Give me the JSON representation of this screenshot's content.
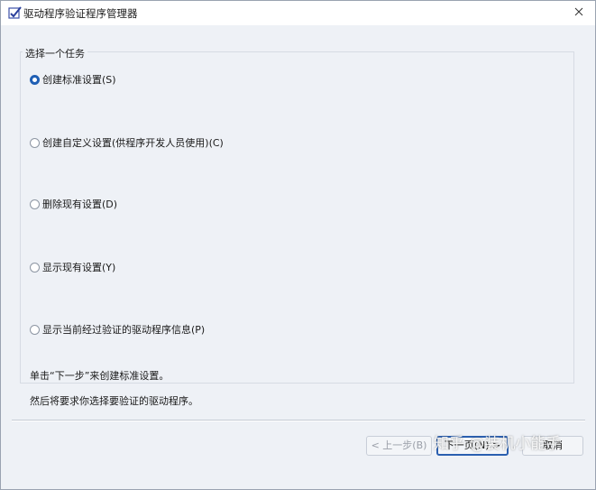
{
  "window": {
    "title": "驱动程序验证程序管理器",
    "app_icon": "checklist-app-icon",
    "close_icon": "close-icon"
  },
  "task_group": {
    "legend": "选择一个任务",
    "options": [
      {
        "label": "创建标准设置(S)",
        "checked": true
      },
      {
        "label": "创建自定义设置(供程序开发人员使用)(C)",
        "checked": false
      },
      {
        "label": "删除现有设置(D)",
        "checked": false
      },
      {
        "label": "显示现有设置(Y)",
        "checked": false
      },
      {
        "label": "显示当前经过验证的驱动程序信息(P)",
        "checked": false
      }
    ]
  },
  "info": {
    "line1": "单击“下一步”来创建标准设置。",
    "line2": "然后将要求你选择要验证的驱动程序。"
  },
  "buttons": {
    "back": "< 上一步(B)",
    "next": "下一页(N) >",
    "cancel": "取消"
  },
  "watermark": "知乎 @装机小能手",
  "colors": {
    "accent": "#1f5fb4",
    "background": "#eef1f6"
  }
}
